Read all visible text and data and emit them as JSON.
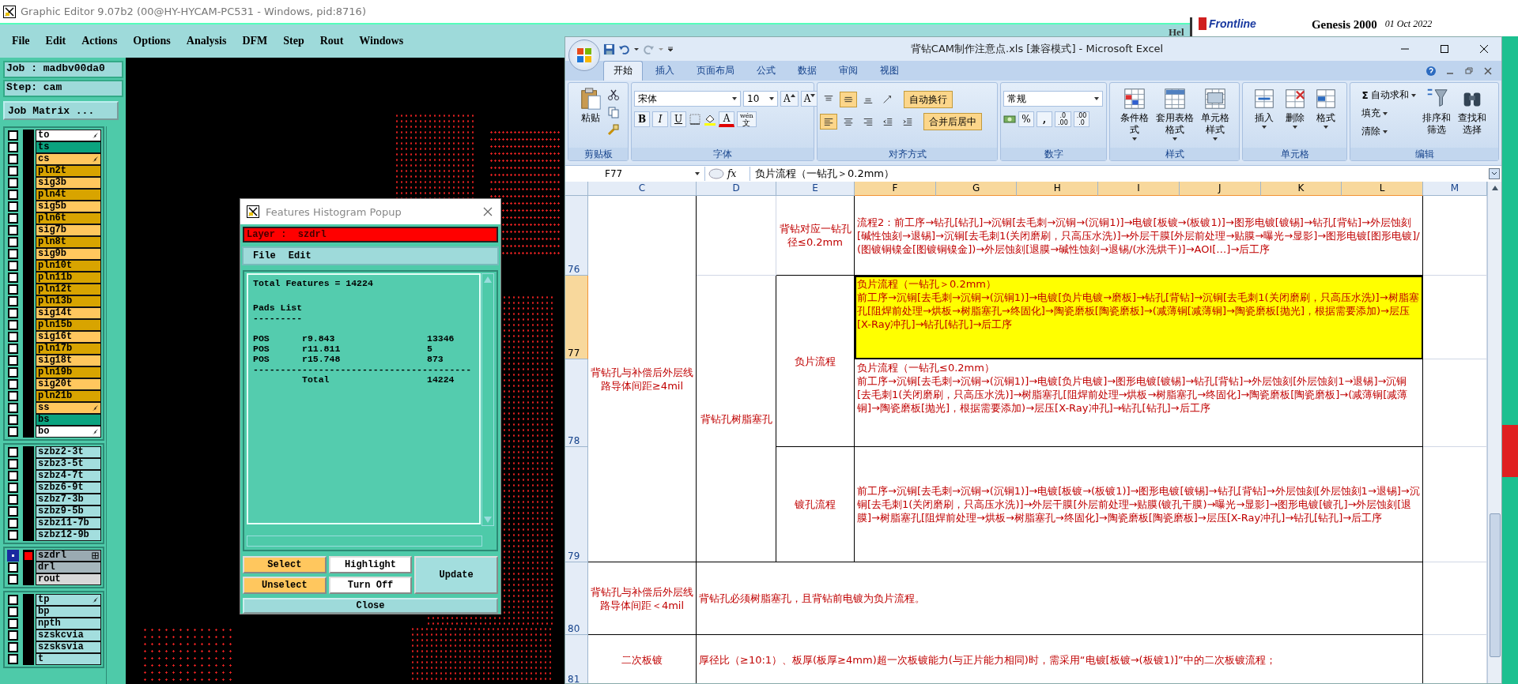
{
  "genesis": {
    "title": "Graphic Editor 9.07b2 (00@HY-HYCAM-PC531 - Windows, pid:8716)",
    "menu": [
      {
        "label": "File"
      },
      {
        "label": "Edit"
      },
      {
        "label": "Actions"
      },
      {
        "label": "Options"
      },
      {
        "label": "Analysis"
      },
      {
        "label": "DFM"
      },
      {
        "label": "Step"
      },
      {
        "label": "Rout"
      },
      {
        "label": "Windows"
      }
    ],
    "help_menu": "Hel",
    "brand": {
      "logo": "Frontline",
      "product": "Genesis 2000",
      "date": "01 Oct 2022"
    },
    "job": "Job : madbv00da0",
    "step": "Step: cam",
    "job_matrix": "Job Matrix ...",
    "layer_groups": [
      {
        "layers": [
          {
            "name": "to",
            "color": "#ffffff",
            "flag": true,
            "grid": false,
            "work": false
          },
          {
            "name": "ts",
            "color": "#0aa37f",
            "flag": false,
            "grid": false,
            "work": false
          },
          {
            "name": "cs",
            "color": "#ffc75e",
            "flag": true,
            "grid": false,
            "work": false
          },
          {
            "name": "pln2t",
            "color": "#d8a400",
            "flag": false,
            "grid": false,
            "work": false
          },
          {
            "name": "sig3b",
            "color": "#ffc75e",
            "flag": false,
            "grid": false,
            "work": false
          },
          {
            "name": "pln4t",
            "color": "#d8a400",
            "flag": false,
            "grid": false,
            "work": false
          },
          {
            "name": "sig5b",
            "color": "#ffc75e",
            "flag": false,
            "grid": false,
            "work": false
          },
          {
            "name": "pln6t",
            "color": "#d8a400",
            "flag": false,
            "grid": false,
            "work": false
          },
          {
            "name": "sig7b",
            "color": "#ffc75e",
            "flag": false,
            "grid": false,
            "work": false
          },
          {
            "name": "pln8t",
            "color": "#d8a400",
            "flag": false,
            "grid": false,
            "work": false
          },
          {
            "name": "sig9b",
            "color": "#ffc75e",
            "flag": false,
            "grid": false,
            "work": false
          },
          {
            "name": "pln10t",
            "color": "#d8a400",
            "flag": false,
            "grid": false,
            "work": false
          },
          {
            "name": "pln11b",
            "color": "#d8a400",
            "flag": false,
            "grid": false,
            "work": false
          },
          {
            "name": "pln12t",
            "color": "#d8a400",
            "flag": false,
            "grid": false,
            "work": false
          },
          {
            "name": "pln13b",
            "color": "#d8a400",
            "flag": false,
            "grid": false,
            "work": false
          },
          {
            "name": "sig14t",
            "color": "#ffc75e",
            "flag": false,
            "grid": false,
            "work": false
          },
          {
            "name": "pln15b",
            "color": "#d8a400",
            "flag": false,
            "grid": false,
            "work": false
          },
          {
            "name": "sig16t",
            "color": "#ffc75e",
            "flag": false,
            "grid": false,
            "work": false
          },
          {
            "name": "pln17b",
            "color": "#d8a400",
            "flag": false,
            "grid": false,
            "work": false
          },
          {
            "name": "sig18t",
            "color": "#ffc75e",
            "flag": false,
            "grid": false,
            "work": false
          },
          {
            "name": "pln19b",
            "color": "#d8a400",
            "flag": false,
            "grid": false,
            "work": false
          },
          {
            "name": "sig20t",
            "color": "#ffc75e",
            "flag": false,
            "grid": false,
            "work": false
          },
          {
            "name": "pln21b",
            "color": "#d8a400",
            "flag": false,
            "grid": false,
            "work": false
          },
          {
            "name": "ss",
            "color": "#ffc75e",
            "flag": true,
            "grid": false,
            "work": false
          },
          {
            "name": "bs",
            "color": "#0aa37f",
            "flag": false,
            "grid": false,
            "work": false
          },
          {
            "name": "bo",
            "color": "#ffffff",
            "flag": true,
            "grid": false,
            "work": false
          }
        ]
      },
      {
        "layers": [
          {
            "name": "szbz2-3t",
            "color": "#a3dede",
            "flag": false,
            "grid": false,
            "work": false
          },
          {
            "name": "szbz3-5t",
            "color": "#a3dede",
            "flag": false,
            "grid": false,
            "work": false
          },
          {
            "name": "szbz4-7t",
            "color": "#a3dede",
            "flag": false,
            "grid": false,
            "work": false
          },
          {
            "name": "szbz6-9t",
            "color": "#a3dede",
            "flag": false,
            "grid": false,
            "work": false
          },
          {
            "name": "szbz7-3b",
            "color": "#a3dede",
            "flag": false,
            "grid": false,
            "work": false
          },
          {
            "name": "szbz9-5b",
            "color": "#a3dede",
            "flag": false,
            "grid": false,
            "work": false
          },
          {
            "name": "szbz11-7b",
            "color": "#a3dede",
            "flag": false,
            "grid": false,
            "work": false
          },
          {
            "name": "szbz12-9b",
            "color": "#a3dede",
            "flag": false,
            "grid": false,
            "work": false
          }
        ]
      },
      {
        "layers": [
          {
            "name": "szdrl",
            "color": "#9aaab2",
            "flag": false,
            "grid": true,
            "work": true
          },
          {
            "name": "drl",
            "color": "#a6b6bc",
            "flag": false,
            "grid": false,
            "work": false
          },
          {
            "name": "rout",
            "color": "#d8d8d8",
            "flag": false,
            "grid": false,
            "work": false
          }
        ]
      },
      {
        "layers": [
          {
            "name": "tp",
            "color": "#a3dede",
            "flag": true,
            "grid": false,
            "work": false
          },
          {
            "name": "bp",
            "color": "#a3dede",
            "flag": false,
            "grid": false,
            "work": false
          },
          {
            "name": "npth",
            "color": "#a3dede",
            "flag": false,
            "grid": false,
            "work": false
          },
          {
            "name": "szskcvia",
            "color": "#a3dede",
            "flag": false,
            "grid": false,
            "work": false
          },
          {
            "name": "szsksvia",
            "color": "#a3dede",
            "flag": false,
            "grid": false,
            "work": false
          },
          {
            "name": "t",
            "color": "#a3dede",
            "flag": false,
            "grid": false,
            "work": false
          }
        ]
      }
    ]
  },
  "popup": {
    "title": "Features Histogram Popup",
    "layer": "Layer :  szdrl",
    "menu": [
      {
        "label": "File"
      },
      {
        "label": "Edit"
      }
    ],
    "report": {
      "title": "Total Features = 14224",
      "heading": "Pads List",
      "underline": "---------",
      "pads": [
        {
          "type": "POS",
          "symbol": "r9.843",
          "count": "13346"
        },
        {
          "type": "POS",
          "symbol": "r11.811",
          "count": "5"
        },
        {
          "type": "POS",
          "symbol": "r15.748",
          "count": "873"
        }
      ],
      "divider": "----------------------------------------",
      "total_label": "Total",
      "total_count": "14224"
    },
    "buttons": [
      {
        "label": "Select",
        "color": "#ffc75e"
      },
      {
        "label": "Highlight",
        "color": "#ffffff"
      },
      {
        "label": "Update",
        "color": "#a3dede"
      },
      {
        "label": "Unselect",
        "color": "#ffc75e"
      },
      {
        "label": "Turn Off",
        "color": "#ffffff"
      }
    ],
    "close": "Close"
  },
  "excel": {
    "title": "背钻CAM制作注意点.xls  [兼容模式] - Microsoft Excel",
    "tabs": [
      {
        "label": "开始",
        "selected": true
      },
      {
        "label": "插入",
        "selected": false
      },
      {
        "label": "页面布局",
        "selected": false
      },
      {
        "label": "公式",
        "selected": false
      },
      {
        "label": "数据",
        "selected": false
      },
      {
        "label": "审阅",
        "selected": false
      },
      {
        "label": "视图",
        "selected": false
      }
    ],
    "ribbon": {
      "clipboard": {
        "label": "剪贴板",
        "paste": "粘贴"
      },
      "font": {
        "label": "字体",
        "name": "宋体",
        "size": "10",
        "grow": "A",
        "shrink": "A",
        "bold": "B",
        "italic": "I",
        "underline": "U",
        "font_color": "A",
        "phonetic_top": "wén",
        "phonetic_bottom": "文"
      },
      "alignment": {
        "label": "对齐方式",
        "top_align": false,
        "middle_align": true,
        "bottom_align": false,
        "left_align": true,
        "center_align": false,
        "right_align": false,
        "wrap": "自动换行",
        "wrap_on": true,
        "merge": "合并后居中",
        "merge_on": true
      },
      "number": {
        "label": "数字",
        "format": "常规",
        "percent": "%",
        "comma": ",",
        "decimals": [
          {
            "top": ".0",
            "bottom": ".00"
          },
          {
            "top": ".00",
            "bottom": ".0"
          }
        ]
      },
      "styles": {
        "label": "样式",
        "buttons": [
          {
            "label": "条件格式"
          },
          {
            "label": "套用表格格式"
          },
          {
            "label": "单元格样式"
          }
        ]
      },
      "cells": {
        "label": "单元格",
        "buttons": [
          {
            "label": "插入"
          },
          {
            "label": "删除"
          },
          {
            "label": "格式"
          }
        ]
      },
      "editing": {
        "label": "编辑",
        "sigma": "Σ",
        "autosum": "自动求和",
        "fill": "填充",
        "clear": "清除",
        "sort": "排序和筛选",
        "find": "查找和选择"
      }
    },
    "name_box": "F77",
    "fx": "fx",
    "formula": "负片流程（一钻孔＞0.2mm）",
    "columns": [
      {
        "label": "C",
        "selected": false
      },
      {
        "label": "D",
        "selected": false
      },
      {
        "label": "E",
        "selected": false
      },
      {
        "label": "F",
        "selected": true
      },
      {
        "label": "G",
        "selected": true
      },
      {
        "label": "H",
        "selected": true
      },
      {
        "label": "I",
        "selected": true
      },
      {
        "label": "J",
        "selected": true
      },
      {
        "label": "K",
        "selected": true
      },
      {
        "label": "L",
        "selected": true
      },
      {
        "label": "M",
        "selected": false
      }
    ],
    "rows": [
      {
        "label": "76",
        "selected": false
      },
      {
        "label": "77",
        "selected": true
      },
      {
        "label": "78",
        "selected": false
      },
      {
        "label": "79",
        "selected": false
      },
      {
        "label": "80",
        "selected": false
      },
      {
        "label": "81",
        "selected": false
      }
    ],
    "cells": [
      {
        "text": "背钻孔与补偿后外层线路导体间距≥4mil",
        "selected": false
      },
      {
        "text": "背钻对应一钻孔径≤0.2mm",
        "selected": false
      },
      {
        "text": "流程2：前工序→钻孔[钻孔]→沉铜[去毛刺→沉铜→(沉铜1)]→电镀[板镀→(板镀1)]→图形电镀[镀锡]→钻孔[背钻]→外层蚀刻[碱性蚀刻→退锡]→沉铜[去毛刺1(关闭磨刷，只高压水洗)]→外层干膜[外层前处理→贴膜→曝光→显影]→图形电镀[图形电镀]/(图镀铜镍金[图镀铜镍金])→外层蚀刻[退膜→碱性蚀刻→退锡/(水洗烘干)]→AOI[…]→后工序",
        "selected": false
      },
      {
        "text": "背钻孔树脂塞孔",
        "selected": false
      },
      {
        "text": "负片流程",
        "selected": false
      },
      {
        "heading": "负片流程（一钻孔＞0.2mm）",
        "text": "前工序→沉铜[去毛刺→沉铜→(沉铜1)]→电镀[负片电镀→磨板]→钻孔[背钻]→沉铜[去毛刺1(关闭磨刷，只高压水洗)]→树脂塞孔[阻焊前处理→烘板→树脂塞孔→终固化]→陶瓷磨板[陶瓷磨板]→(减薄铜[减薄铜]→陶瓷磨板[抛光]，根据需要添加)→层压[X-Ray冲孔]→钻孔[钻孔]→后工序",
        "selected": true
      },
      {
        "heading": "负片流程（一钻孔≤0.2mm）",
        "text": "前工序→沉铜[去毛刺→沉铜→(沉铜1)]→电镀[负片电镀]→图形电镀[镀锡]→钻孔[背钻]→外层蚀刻[外层蚀刻1→退锡]→沉铜[去毛刺1(关闭磨刷，只高压水洗)]→树脂塞孔[阻焊前处理→烘板→树脂塞孔→终固化]→陶瓷磨板[陶瓷磨板]→(减薄铜[减薄铜]→陶瓷磨板[抛光]，根据需要添加)→层压[X-Ray冲孔]→钻孔[钻孔]→后工序",
        "selected": false
      },
      {
        "text": "镀孔流程",
        "selected": false
      },
      {
        "text": "前工序→沉铜[去毛刺→沉铜→(沉铜1)]→电镀[板镀→(板镀1)]→图形电镀[镀锡]→钻孔[背钻]→外层蚀刻[外层蚀刻1→退锡]→沉铜[去毛刺1(关闭磨刷，只高压水洗)]→外层干膜[外层前处理→贴膜(镀孔干膜)→曝光→显影]→图形电镀[镀孔]→外层蚀刻[退膜]→树脂塞孔[阻焊前处理→烘板→树脂塞孔→终固化]→陶瓷磨板[陶瓷磨板]→层压[X-Ray冲孔]→钻孔[钻孔]→后工序",
        "selected": false
      },
      {
        "text": "背钻孔与补偿后外层线路导体间距＜4mil",
        "selected": false
      },
      {
        "text": "背钻孔必须树脂塞孔，且背钻前电镀为负片流程。",
        "selected": false
      },
      {
        "text": "二次板镀",
        "selected": false
      },
      {
        "text": "厚径比（≥10:1）、板厚(板厚≥4mm)超一次板镀能力(与正片能力相同)时，需采用“电镀[板镀→(板镀1)]”中的二次板镀流程；",
        "selected": false
      }
    ]
  }
}
